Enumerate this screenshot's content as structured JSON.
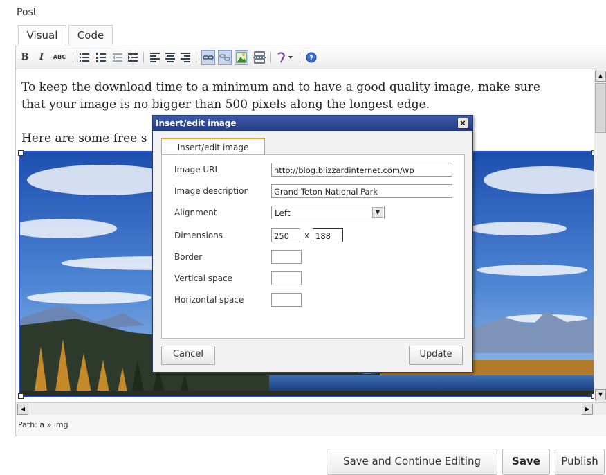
{
  "post_label": "Post",
  "tabs": {
    "visual": "Visual",
    "code": "Code"
  },
  "toolbar": {
    "bold": "B",
    "italic": "I",
    "strike": "ABC"
  },
  "editor": {
    "paragraph1": "To keep the download time to a minimum and to have a good quality image, make sure that your image is no bigger than 500 pixels along the longest edge.",
    "paragraph2": "Here are some free s"
  },
  "dialog": {
    "title": "Insert/edit image",
    "close": "×",
    "tab": "Insert/edit image",
    "fields": {
      "image_url_label": "Image URL",
      "image_url_value": "http://blog.blizzardinternet.com/wp",
      "description_label": "Image description",
      "description_value": "Grand Teton National Park",
      "alignment_label": "Alignment",
      "alignment_value": "Left",
      "dimensions_label": "Dimensions",
      "width_value": "250",
      "times": "x",
      "height_value": "188",
      "border_label": "Border",
      "border_value": "",
      "vspace_label": "Vertical space",
      "vspace_value": "",
      "hspace_label": "Horizontal space",
      "hspace_value": ""
    },
    "cancel": "Cancel",
    "update": "Update"
  },
  "status": {
    "path": "Path: a » img"
  },
  "buttons": {
    "save_continue": "Save and Continue Editing",
    "save": "Save",
    "publish": "Publish"
  },
  "colors": {
    "dialog_title_bg": "#2f4b97",
    "selection_outline": "#1f4fd0",
    "tab_accent": "#e8a53a"
  }
}
